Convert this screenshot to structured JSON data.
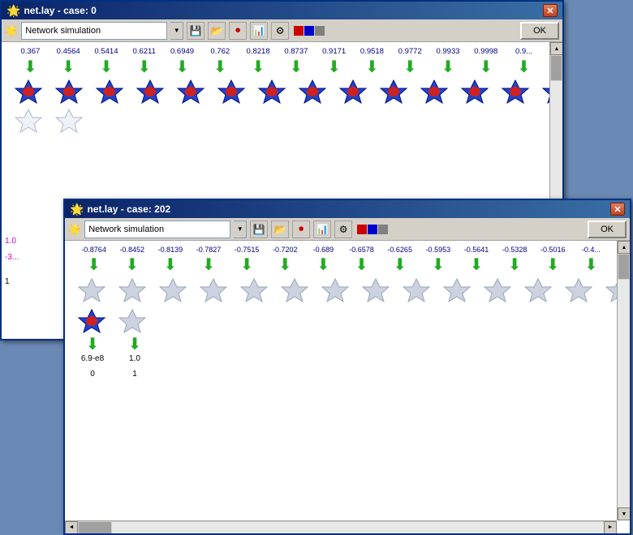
{
  "window1": {
    "title": "net.lay - case: 0",
    "toolbar": {
      "dropdown_label": "Network simulation",
      "ok_label": "OK"
    },
    "values": [
      "0.367",
      "0.4564",
      "0.5414",
      "0.6211",
      "0.6949",
      "0.762",
      "0.8218",
      "0.8737",
      "0.9171",
      "0.9518",
      "0.9772",
      "0.9933",
      "0.9998",
      "0.9..."
    ],
    "side_labels": [
      "1.0",
      "-3...",
      "1"
    ]
  },
  "window2": {
    "title": "net.lay - case: 202",
    "toolbar": {
      "dropdown_label": "Network simulation",
      "ok_label": "OK"
    },
    "values": [
      "-0.8764",
      "-0.8452",
      "-0.8139",
      "-0.7827",
      "-0.7515",
      "-0.7202",
      "-0.689",
      "-0.6578",
      "-0.6265",
      "-0.5953",
      "-0.5641",
      "-0.5328",
      "-0.5016",
      "-0.4..."
    ],
    "bottom_values": [
      "6.9-e8",
      "1.0"
    ],
    "bottom_labels": [
      "0",
      "1"
    ]
  },
  "icons": {
    "close": "✕",
    "arrow_down": "▼",
    "arrow_left": "◄",
    "arrow_right": "►",
    "arrow_up": "▲",
    "save": "💾",
    "star": "★"
  }
}
